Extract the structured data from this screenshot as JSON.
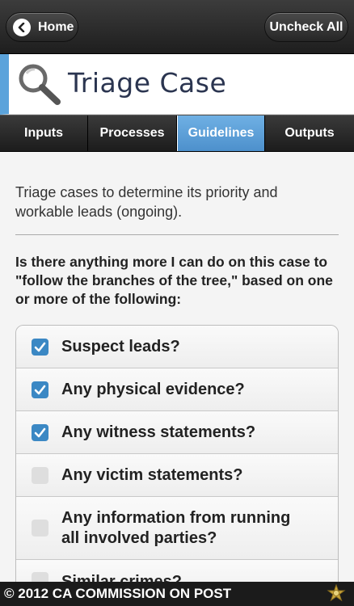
{
  "header": {
    "home_label": "Home",
    "uncheck_all_label": "Uncheck All"
  },
  "banner": {
    "title": "Triage Case",
    "icon": "magnifier-icon"
  },
  "tabs": [
    {
      "label": "Inputs",
      "active": false
    },
    {
      "label": "Processes",
      "active": false
    },
    {
      "label": "Guidelines",
      "active": true
    },
    {
      "label": "Outputs",
      "active": false
    }
  ],
  "content": {
    "intro": "Triage cases to determine its priority and workable leads (ongoing).",
    "question": "Is there anything more I can do on this case to \"follow the branches of the tree,\" based on one or more of the following:",
    "items": [
      {
        "label": "Suspect leads?",
        "checked": true
      },
      {
        "label": "Any physical evidence?",
        "checked": true
      },
      {
        "label": "Any witness statements?",
        "checked": true
      },
      {
        "label": "Any victim statements?",
        "checked": false
      },
      {
        "label": "Any information from running all involved parties?",
        "checked": false
      },
      {
        "label": "Similar crimes?",
        "checked": false
      }
    ]
  },
  "footer": {
    "text": "© 2012 CA COMMISSION ON POST",
    "icon": "post-badge-icon"
  },
  "colors": {
    "accent": "#5ba3db",
    "checkbox_checked": "#3b88c4",
    "tab_active": "#5b9fd8"
  }
}
